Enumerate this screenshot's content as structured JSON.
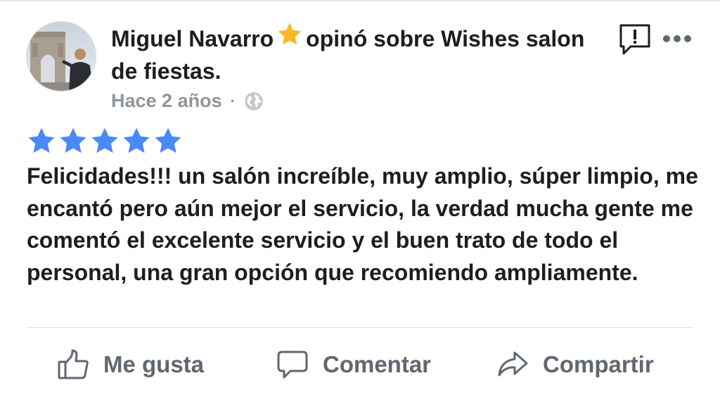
{
  "post": {
    "author": "Miguel Navarro",
    "verb": "opinó sobre",
    "page_name": "Wishes salon de fiestas.",
    "timestamp": "Hace 2 años",
    "separator": "·",
    "rating": 5,
    "review": "Felicidades!!! un salón increíble, muy amplio, súper limpio, me encantó pero aún mejor el servicio, la verdad mucha gente me comentó el excelente servicio y el buen trato de todo el personal, una gran opción que recomiendo ampliamente."
  },
  "actions": {
    "like_label": "Me gusta",
    "comment_label": "Comentar",
    "share_label": "Compartir"
  },
  "icons": {
    "recommendation": "star-icon",
    "audience": "globe-icon",
    "report": "report-icon",
    "more": "more-icon",
    "like": "thumbs-up-icon",
    "comment": "comment-bubble-icon",
    "share": "share-arrow-icon"
  },
  "colors": {
    "rating_star": "#4a89f7",
    "recommend_star": "#f7b928",
    "muted_text": "#90949c",
    "action_text": "#606770"
  }
}
